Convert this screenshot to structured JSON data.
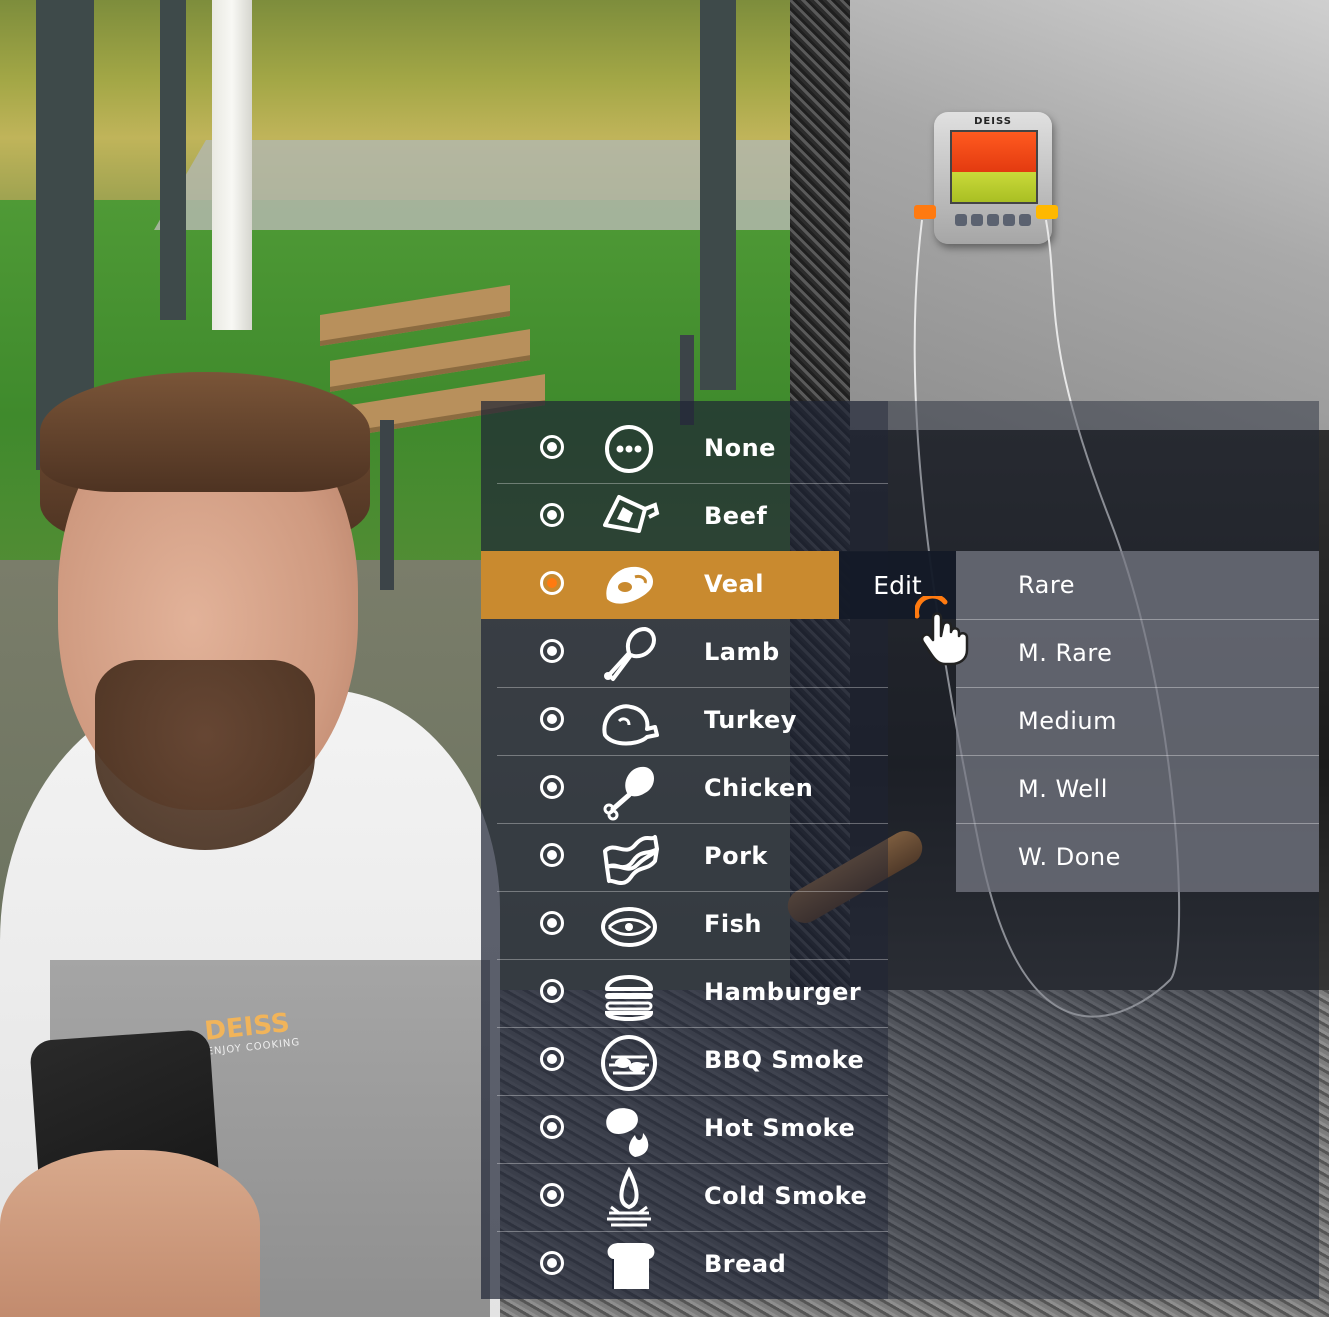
{
  "thermometer": {
    "brand": "DEISS"
  },
  "apron": {
    "logo": "DEISS",
    "tagline": "ENJOY COOKING"
  },
  "menu": {
    "items": [
      {
        "label": "None",
        "icon": "more-dots-icon",
        "selected": false
      },
      {
        "label": "Beef",
        "icon": "beef-icon",
        "selected": false
      },
      {
        "label": "Veal",
        "icon": "veal-steak-icon",
        "selected": true
      },
      {
        "label": "Lamb",
        "icon": "lamb-leg-icon",
        "selected": false
      },
      {
        "label": "Turkey",
        "icon": "turkey-icon",
        "selected": false
      },
      {
        "label": "Chicken",
        "icon": "chicken-leg-icon",
        "selected": false
      },
      {
        "label": "Pork",
        "icon": "pork-bacon-icon",
        "selected": false
      },
      {
        "label": "Fish",
        "icon": "fish-steak-icon",
        "selected": false
      },
      {
        "label": "Hamburger",
        "icon": "hamburger-icon",
        "selected": false
      },
      {
        "label": "BBQ Smoke",
        "icon": "bbq-grill-icon",
        "selected": false
      },
      {
        "label": "Hot Smoke",
        "icon": "hot-smoke-icon",
        "selected": false
      },
      {
        "label": "Cold Smoke",
        "icon": "cold-smoke-icon",
        "selected": false
      },
      {
        "label": "Bread",
        "icon": "bread-icon",
        "selected": false
      }
    ],
    "edit_label": "Edit",
    "doneness": [
      "Rare",
      "M. Rare",
      "Medium",
      "M. Well",
      "W. Done"
    ],
    "accent_color": "#c98a2f",
    "cursor_icon": "hand-pointer-icon"
  }
}
